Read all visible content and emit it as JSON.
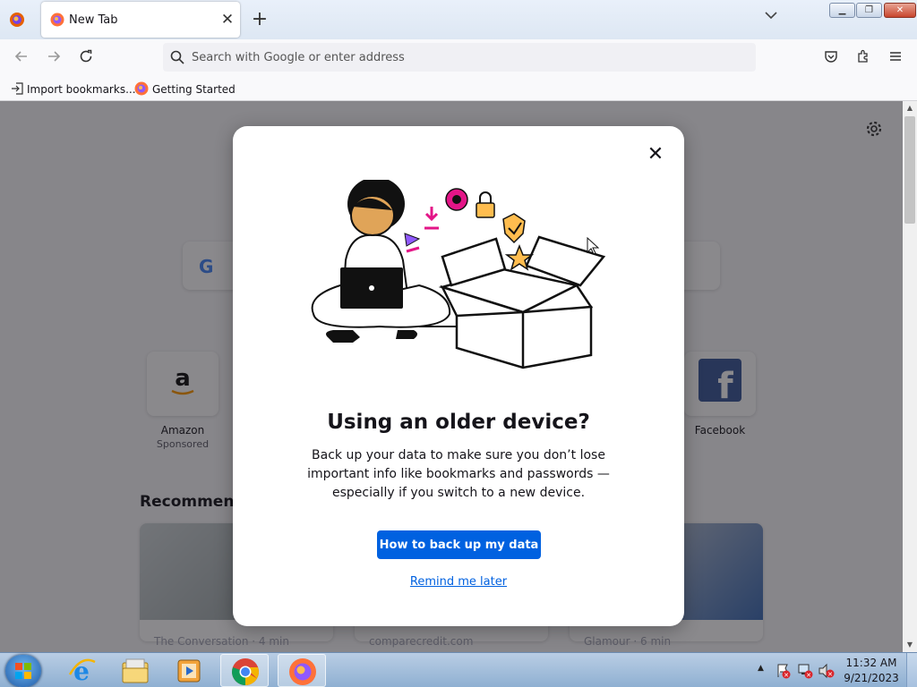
{
  "browser": {
    "tab": {
      "title": "New Tab"
    },
    "url_placeholder": "Search with Google or enter address",
    "bookmarks": [
      {
        "label": "Import bookmarks..."
      },
      {
        "label": "Getting Started"
      }
    ]
  },
  "newtab": {
    "top_sites": [
      {
        "name": "Amazon",
        "sub": "Sponsored",
        "icon": "amazon-icon"
      },
      {
        "name": "Facebook",
        "sub": "",
        "icon": "facebook-icon"
      }
    ],
    "recommended_heading": "Recommende",
    "cards": [
      {
        "source": "The Conversation · 4 min"
      },
      {
        "source": "comparecredit.com"
      },
      {
        "source": "Glamour · 6 min"
      }
    ]
  },
  "modal": {
    "title": "Using an older device?",
    "body": "Back up your data to make sure you don’t lose important info like bookmarks and passwords — especially if you switch to a new device.",
    "primary_button": "How to back up my data",
    "secondary_link": "Remind me later"
  },
  "taskbar": {
    "clock_time": "11:32 AM",
    "clock_date": "9/21/2023"
  },
  "colors": {
    "accent_blue": "#0061e0",
    "overlay": "#15141a",
    "taskbar": "#9fbbdb"
  }
}
